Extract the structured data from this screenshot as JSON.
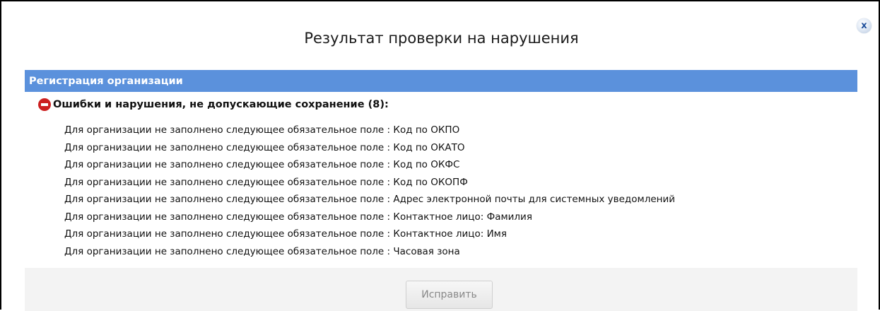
{
  "dialog": {
    "title": "Результат проверки на нарушения",
    "close_icon": "close-icon",
    "close_label": "x"
  },
  "section": {
    "header": "Регистрация организации",
    "header_color": "#5b91dc",
    "errors_heading": "Ошибки и нарушения, не допускающие сохранение (8):",
    "errors_icon": "stop-icon",
    "errors": [
      "Для организации не заполнено следующее обязательное поле : Код по ОКПО",
      "Для организации не заполнено следующее обязательное поле : Код по ОКАТО",
      "Для организации не заполнено следующее обязательное поле : Код по ОКФС",
      "Для организации не заполнено следующее обязательное поле : Код по ОКОПФ",
      "Для организации не заполнено следующее обязательное поле : Адрес электронной почты для системных уведомлений",
      "Для организации не заполнено следующее обязательное поле : Контактное лицо: Фамилия",
      "Для организации не заполнено следующее обязательное поле : Контактное лицо: Имя",
      "Для организации не заполнено следующее обязательное поле : Часовая зона"
    ]
  },
  "footer": {
    "fix_button_label": "Исправить"
  }
}
